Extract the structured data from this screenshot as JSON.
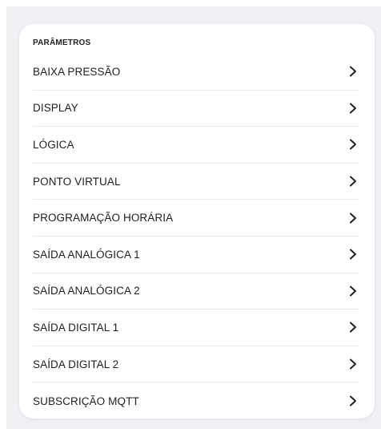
{
  "section": {
    "title": "PARÂMETROS"
  },
  "items": [
    {
      "label": "BAIXA PRESSÃO"
    },
    {
      "label": "DISPLAY"
    },
    {
      "label": "LÓGICA"
    },
    {
      "label": "PONTO VIRTUAL"
    },
    {
      "label": "PROGRAMAÇÃO HORÁRIA"
    },
    {
      "label": "SAÍDA ANALÓGICA 1"
    },
    {
      "label": "SAÍDA ANALÓGICA 2"
    },
    {
      "label": "SAÍDA DIGITAL 1"
    },
    {
      "label": "SAÍDA DIGITAL 2"
    },
    {
      "label": "SUBSCRIÇÃO MQTT"
    }
  ],
  "icons": {
    "row_trailing": "chevron-right-icon"
  },
  "colors": {
    "background": "#f0f0f4",
    "card": "#ffffff",
    "text": "#1f1f1f",
    "divider": "#ececec"
  }
}
